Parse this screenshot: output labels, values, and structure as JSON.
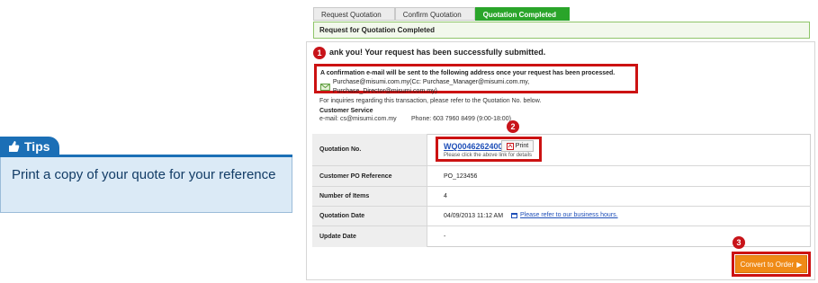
{
  "tips": {
    "tab_label": "Tips",
    "text": "Print a copy of your quote for your reference"
  },
  "steps": [
    {
      "label": "Request Quotation"
    },
    {
      "label": "Confirm Quotation"
    },
    {
      "label": "Quotation Completed"
    }
  ],
  "title": "Request for Quotation Completed",
  "thanks": "ank you! Your request has been successfully submitted.",
  "confirm": {
    "line1": "A confirmation e-mail will be sent to the following address once your request has been processed.",
    "emails": "Purchase@misumi.com.my(Cc: Purchase_Manager@misumi.com.my, Purchase_Director@misumi.com.my)"
  },
  "inquiry": "For inquiries regarding this transaction, please refer to the Quotation No. below.",
  "customer_service": {
    "title": "Customer Service",
    "email": "e-mail: cs@misumi.com.my",
    "phone": "Phone: 603 7960 8499 (9:00-18:00)"
  },
  "table": {
    "rows": [
      {
        "label": "Quotation No.",
        "value": ""
      },
      {
        "label": "Customer PO Reference",
        "value": "PO_123456"
      },
      {
        "label": "Number of Items",
        "value": "4"
      },
      {
        "label": "Quotation Date",
        "value": "04/09/2013 11:12 AM"
      },
      {
        "label": "Update Date",
        "value": "-"
      }
    ],
    "quotation_no": "WQ0046262400",
    "print_label": "Print",
    "print_note": "Please click the above link for details",
    "hours_link": "Please refer to our business hours."
  },
  "convert_label": "Convert to Order",
  "badges": {
    "one": "1",
    "two": "2",
    "three": "3"
  },
  "colors": {
    "accent_green": "#2aa52a",
    "highlight_red": "#cc1212",
    "tips_blue": "#1b6fb6",
    "convert_orange": "#ef8a16"
  }
}
